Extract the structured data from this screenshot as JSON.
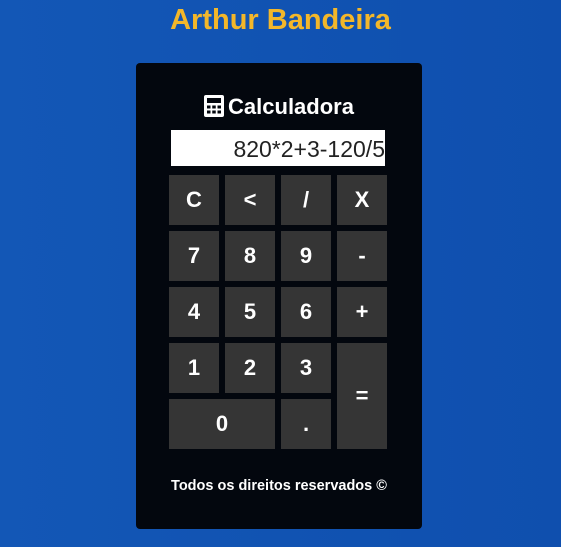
{
  "page": {
    "title": "Arthur Bandeira"
  },
  "calculator": {
    "title": "Calculadora",
    "display_value": "820*2+3-120/5",
    "keys": {
      "clear": "C",
      "backspace": "<",
      "divide": "/",
      "multiply": "X",
      "seven": "7",
      "eight": "8",
      "nine": "9",
      "minus": "-",
      "four": "4",
      "five": "5",
      "six": "6",
      "plus": "+",
      "one": "1",
      "two": "2",
      "three": "3",
      "equals": "=",
      "zero": "0",
      "decimal": "."
    },
    "footer": "Todos os direitos reservados ©"
  },
  "icons": {
    "header_icon": "calculator-icon"
  },
  "colors": {
    "background": "#1357b6",
    "title": "#f3b72a",
    "card": "#03070e",
    "key": "#353535"
  }
}
